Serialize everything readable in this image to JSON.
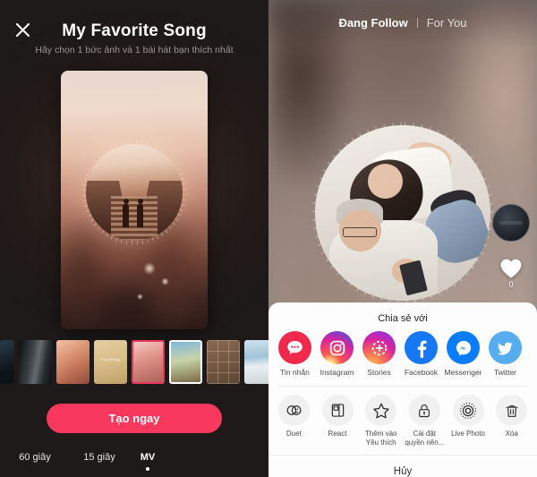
{
  "left_panel": {
    "close_icon": "close-icon",
    "title": "My Favorite Song",
    "subtitle": "Hãy chọn 1 bức ảnh và 1 bài hát bạn thích nhất",
    "preview": {
      "name": "photo-music-preview",
      "description": "Couple holding hands on stairs at sunset with circular dotted ring mask"
    },
    "thumbnails": [
      {
        "name": "thumb-0",
        "class": "t0",
        "caption": "",
        "selected": false,
        "partial": "left"
      },
      {
        "name": "thumb-1",
        "class": "t1",
        "caption": "",
        "selected": false,
        "partial": ""
      },
      {
        "name": "thumb-2",
        "class": "t2",
        "caption": "",
        "selected": false,
        "partial": ""
      },
      {
        "name": "thumb-3",
        "class": "t3",
        "caption": "Keep Smiling",
        "selected": false,
        "partial": ""
      },
      {
        "name": "thumb-4",
        "class": "t4",
        "caption": "",
        "selected": true,
        "partial": ""
      },
      {
        "name": "thumb-5",
        "class": "t5",
        "caption": "",
        "selected": false,
        "partial": ""
      },
      {
        "name": "thumb-6",
        "class": "t6",
        "caption": "",
        "selected": false,
        "partial": ""
      },
      {
        "name": "thumb-7",
        "class": "t7",
        "caption": "",
        "selected": false,
        "partial": ""
      },
      {
        "name": "thumb-8",
        "class": "t8",
        "caption": "",
        "selected": false,
        "partial": "right"
      }
    ],
    "create_button": "Tạo ngay",
    "modes": [
      {
        "label": "60 giây",
        "active": false
      },
      {
        "label": "15 giây",
        "active": false
      },
      {
        "label": "MV",
        "active": true
      }
    ]
  },
  "right_panel": {
    "tabs": [
      {
        "label": "Đang Follow",
        "active": true
      },
      {
        "label": "For You",
        "active": false
      }
    ],
    "avatar": "user-avatar",
    "like": {
      "icon": "heart-icon",
      "count": "0"
    },
    "share_sheet": {
      "title": "Chia sẻ với",
      "share_targets": [
        {
          "label": "Tin nhắn",
          "icon": "message-bubble-icon",
          "class": "ic-msg"
        },
        {
          "label": "Instagram",
          "icon": "instagram-icon",
          "class": "ic-ig"
        },
        {
          "label": "Stories",
          "icon": "instagram-stories-icon",
          "class": "ic-story"
        },
        {
          "label": "Facebook",
          "icon": "facebook-icon",
          "class": "ic-fb"
        },
        {
          "label": "Messenger",
          "icon": "messenger-icon",
          "class": "ic-mess"
        },
        {
          "label": "Twitter",
          "icon": "twitter-icon",
          "class": "ic-tw"
        }
      ],
      "actions": [
        {
          "label": "Duet",
          "icon": "duet-icon"
        },
        {
          "label": "React",
          "icon": "react-icon"
        },
        {
          "label": "Thêm vào Yêu thích",
          "icon": "star-icon"
        },
        {
          "label": "Cài đặt quyền riên...",
          "icon": "lock-icon"
        },
        {
          "label": "Live Photo",
          "icon": "live-photo-icon"
        },
        {
          "label": "Xóa",
          "icon": "trash-icon"
        }
      ],
      "cancel": "Hủy"
    }
  },
  "colors": {
    "accent_pink": "#f8385c",
    "selected_thumb_border": "#e8365d",
    "facebook_blue": "#1877f2",
    "messenger_blue": "#0a7cff",
    "twitter_blue": "#55acee",
    "message_red": "#f0294d",
    "sheet_bg": "#fdfdfd",
    "left_bg": "#1d1a19"
  }
}
